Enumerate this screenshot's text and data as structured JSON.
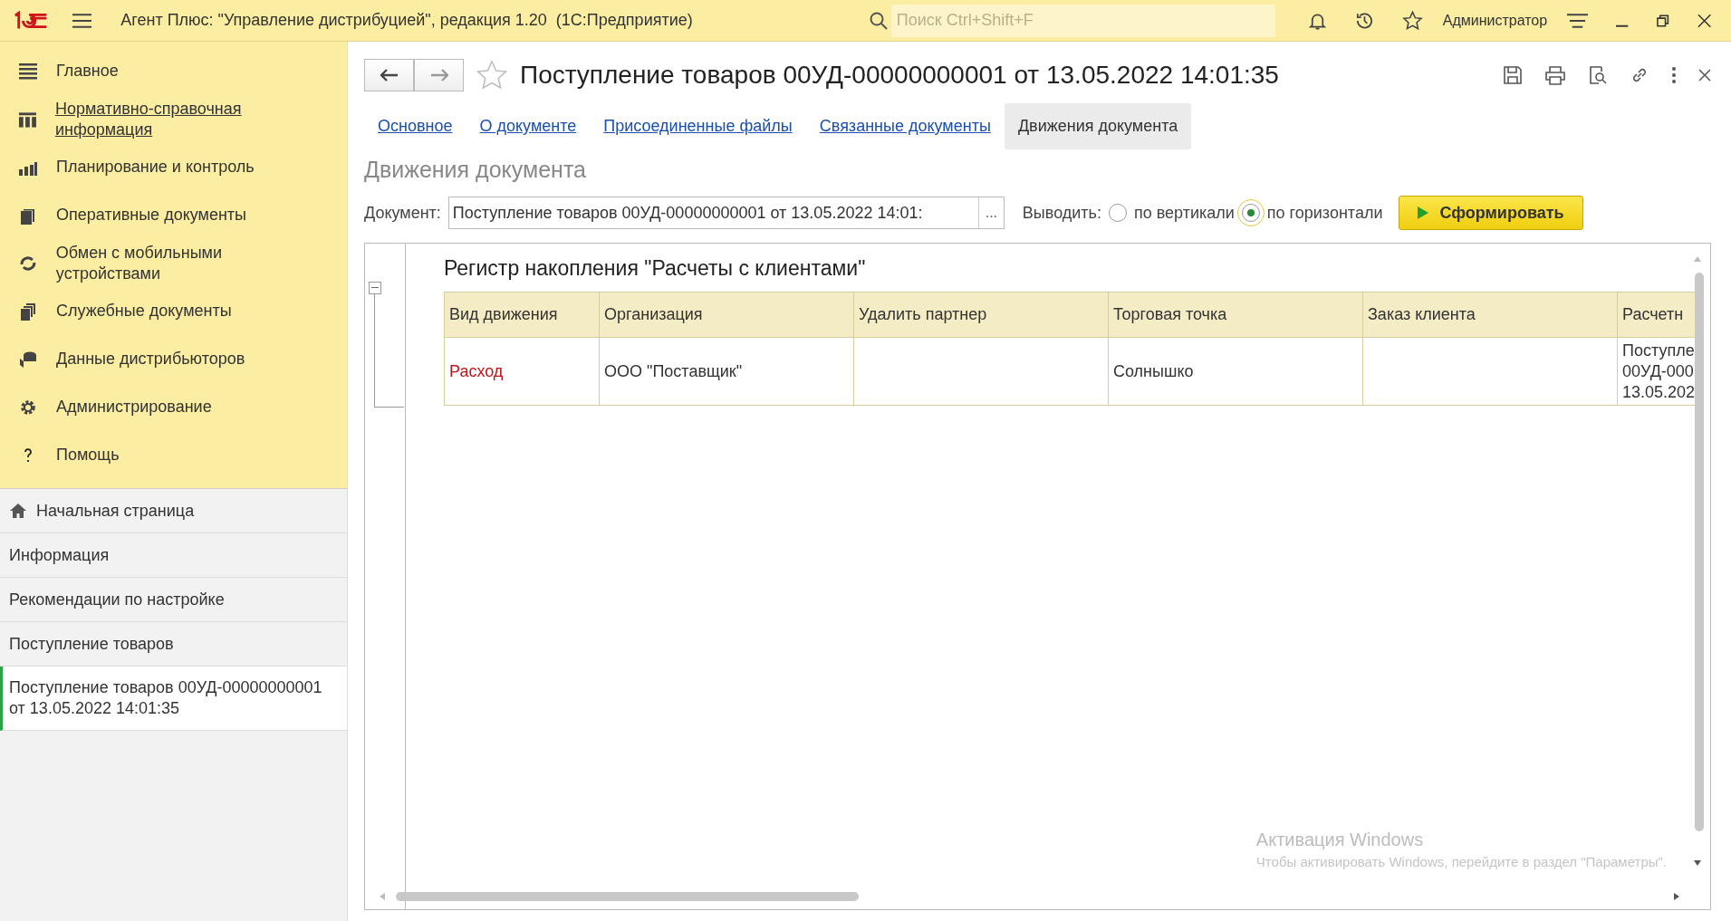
{
  "app": {
    "title": "Агент Плюс: \"Управление дистрибуцией\", редакция 1.20  (1С:Предприятие)",
    "search": {
      "placeholder": "Поиск Ctrl+Shift+F"
    },
    "user": "Администратор"
  },
  "sidebar": {
    "sections": [
      {
        "label": "Главное",
        "kind": "menu",
        "hovered": false
      },
      {
        "label": "Нормативно-справочная информация",
        "kind": "columns",
        "hovered": true
      },
      {
        "label": "Планирование и контроль",
        "kind": "chart",
        "hovered": false
      },
      {
        "label": "Оперативные документы",
        "kind": "docs",
        "hovered": false
      },
      {
        "label": "Обмен с мобильными устройствами",
        "kind": "sync",
        "hovered": false
      },
      {
        "label": "Служебные документы",
        "kind": "stack",
        "hovered": false
      },
      {
        "label": "Данные дистрибьюторов",
        "kind": "data",
        "hovered": false
      },
      {
        "label": "Администрирование",
        "kind": "gear",
        "hovered": false
      },
      {
        "label": "Помощь",
        "kind": "help",
        "hovered": false
      }
    ]
  },
  "open_windows": [
    {
      "label": "Начальная страница",
      "kind": "home",
      "selected": false
    },
    {
      "label": "Информация",
      "kind": "page",
      "selected": false
    },
    {
      "label": "Рекомендации по настройке",
      "kind": "page",
      "selected": false
    },
    {
      "label": "Поступление товаров",
      "kind": "page",
      "selected": false
    },
    {
      "label": "Поступление товаров 00УД-00000000001 от 13.05.2022 14:01:35",
      "kind": "page",
      "selected": true
    }
  ],
  "document": {
    "title": "Поступление товаров 00УД-00000000001 от 13.05.2022 14:01:35",
    "favorite": false,
    "tabs": [
      {
        "label": "Основное",
        "selected": false
      },
      {
        "label": "О документе",
        "selected": false
      },
      {
        "label": "Присоединенные файлы",
        "selected": false
      },
      {
        "label": "Связанные документы",
        "selected": false
      },
      {
        "label": "Движения документа",
        "selected": true
      }
    ],
    "heading": "Движения документа",
    "form": {
      "document_label": "Документ:",
      "document_value": "Поступление товаров 00УД-00000000001 от 13.05.2022 14:01:",
      "choose_button": "...",
      "output_label": "Выводить:",
      "options": [
        {
          "label": "по вертикали",
          "selected": false
        },
        {
          "label": "по горизонтали",
          "selected": true
        }
      ],
      "run_button": "Сформировать"
    },
    "report": {
      "title": "Регистр накопления \"Расчеты с клиентами\"",
      "expanded": true,
      "columns": [
        "Вид движения",
        "Организация",
        "Удалить партнер",
        "Торговая точка",
        "Заказ клиента",
        "Расчетн"
      ],
      "rows": [
        {
          "kind": "expense",
          "cells": [
            "Расход",
            "ООО \"Поставщик\"",
            "",
            "Солнышко",
            "",
            "Поступле\n00УД-000\n13.05.202"
          ]
        }
      ]
    }
  },
  "watermark": {
    "title": "Активация Windows",
    "text": "Чтобы активировать Windows, перейдите в раздел \"Параметры\"."
  }
}
